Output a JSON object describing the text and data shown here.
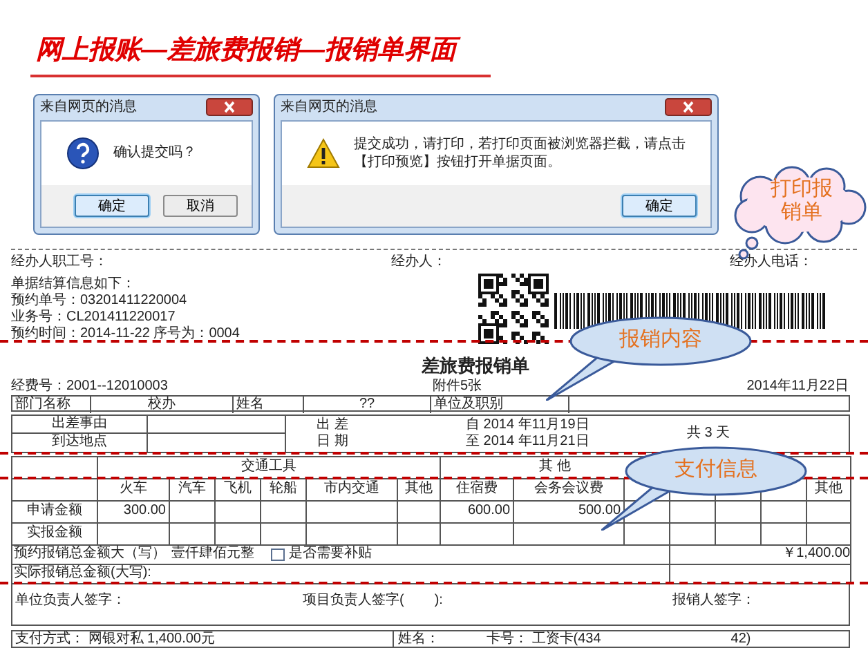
{
  "slide_title": "网上报账—差旅费报销—报销单界面",
  "dialogs": [
    {
      "title": "来自网页的消息",
      "kind": "question",
      "message": "确认提交吗？",
      "buttons": [
        {
          "label": "确定",
          "default": true
        },
        {
          "label": "取消",
          "default": false
        }
      ]
    },
    {
      "title": "来自网页的消息",
      "kind": "warning",
      "message": "提交成功，请打印，若打印页面被浏览器拦截，请点击【打印预览】按钮打开单据页面。",
      "buttons": [
        {
          "label": "确定",
          "default": true
        }
      ]
    }
  ],
  "callouts": [
    {
      "kind": "cloud",
      "text": "打印报销单"
    },
    {
      "kind": "oval",
      "text": "报销内容"
    },
    {
      "kind": "oval",
      "text": "支付信息"
    }
  ],
  "slip": {
    "fields": [
      "经办人职工号：",
      "经办人：",
      "经办人电话："
    ],
    "info_lines": [
      "单据结算信息如下：",
      "预约单号：03201411220004",
      "业务号：CL201411220017",
      "预约时间：2014-11-22 序号为：0004"
    ]
  },
  "form": {
    "title": "差旅费报销单",
    "fund_no": "经费号：2001--12010003",
    "attachments": "附件5张",
    "date": "2014年11月22日",
    "row1": [
      "部门名称",
      "校办",
      "姓名",
      "??",
      "单位及职别"
    ],
    "trip": {
      "reason_label": "出差事由",
      "destination_label": "到达地点",
      "dates_label_1": "出 差",
      "dates_label_2": "日 期",
      "from": "自 2014 年11月19日",
      "to": "至 2014 年11月21日",
      "days": "共 3 天"
    },
    "expense_groups": [
      "交通工具",
      "其 他"
    ],
    "expense_columns": [
      {
        "label": "火车",
        "requested": "300.00"
      },
      {
        "label": "汽车"
      },
      {
        "label": "飞机"
      },
      {
        "label": "轮船"
      },
      {
        "label": "市内交通"
      },
      {
        "label": "其他"
      },
      {
        "label": "住宿费",
        "requested": "600.00"
      },
      {
        "label": "会务会议费",
        "requested": "500.00"
      }
    ],
    "last_column": "其他",
    "amount_rows": [
      "申请金额",
      "实报金额"
    ],
    "totals": {
      "estimate_label": "预约报销总金额大（写）",
      "estimate_words": "壹仟肆佰元整",
      "subsidy": {
        "label": "是否需要补贴",
        "checked": false
      },
      "estimate_amount": "￥1,400.00",
      "actual_label": "实际报销总金额(大写):"
    },
    "signatures": [
      "单位负责人签字：",
      "项目负责人签字(",
      "):",
      "报销人签字："
    ],
    "payment": {
      "method": "支付方式： 网银对私 1,400.00元",
      "name_label": "姓名：",
      "card": "卡号： 工资卡(434",
      "card_end": "42)"
    }
  }
}
